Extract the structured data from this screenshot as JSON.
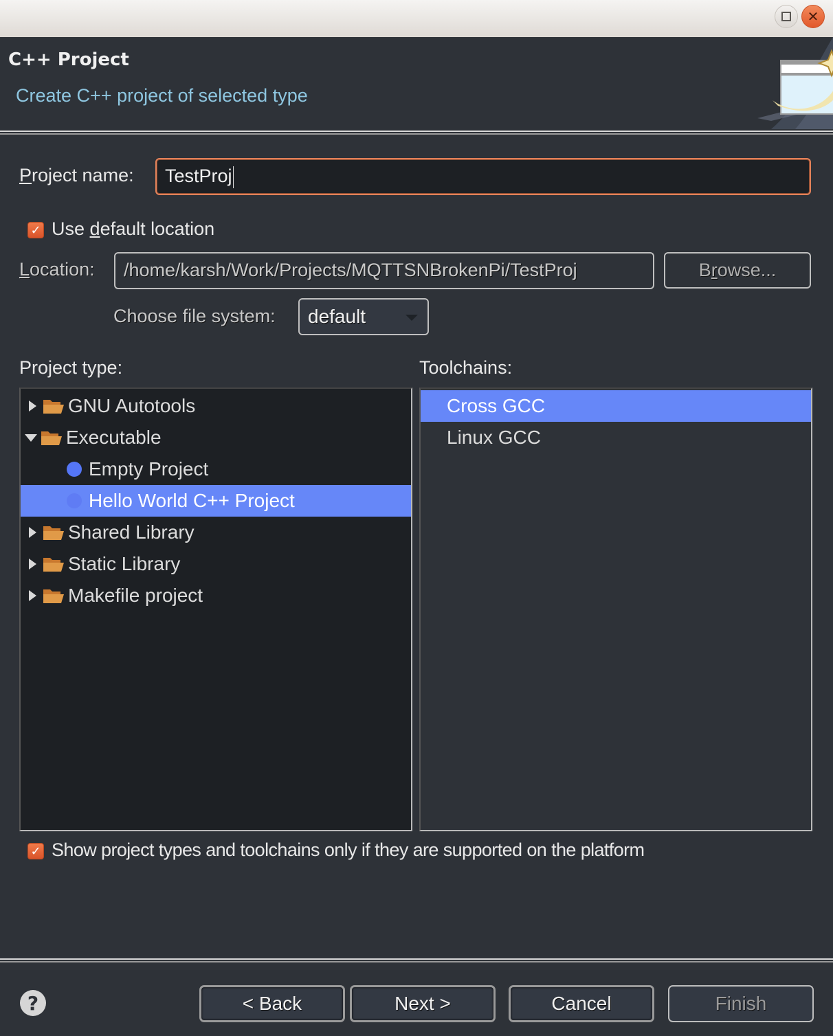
{
  "window": {
    "maximize_icon": "maximize-icon",
    "close_icon": "close-icon"
  },
  "header": {
    "title": "C++ Project",
    "subtitle": "Create C++ project of selected type",
    "banner_icon": "new-project-wizard-icon"
  },
  "form": {
    "project_name_label_mnemonic": "P",
    "project_name_label_rest": "roject name:",
    "project_name_value": "TestProj",
    "use_default_location": {
      "checked": true,
      "label_pre": "Use ",
      "label_mnemonic": "d",
      "label_post": "efault location"
    },
    "location_label_mnemonic": "L",
    "location_label_rest": "ocation:",
    "location_value": "/home/karsh/Work/Projects/MQTTSNBrokenPi/TestProj",
    "browse_pre": "B",
    "browse_mnemonic": "r",
    "browse_post": "owse...",
    "file_system_label": "Choose file system:",
    "file_system_value": "default"
  },
  "project_type": {
    "label": "Project type:",
    "items": [
      {
        "label": "GNU Autotools",
        "kind": "folder",
        "expanded": false,
        "level": 0
      },
      {
        "label": "Executable",
        "kind": "folder",
        "expanded": true,
        "level": 0
      },
      {
        "label": "Empty Project",
        "kind": "leaf",
        "level": 1
      },
      {
        "label": "Hello World C++ Project",
        "kind": "leaf",
        "level": 1,
        "selected": true
      },
      {
        "label": "Shared Library",
        "kind": "folder",
        "expanded": false,
        "level": 0
      },
      {
        "label": "Static Library",
        "kind": "folder",
        "expanded": false,
        "level": 0
      },
      {
        "label": "Makefile project",
        "kind": "folder",
        "expanded": false,
        "level": 0
      }
    ]
  },
  "toolchains": {
    "label": "Toolchains:",
    "items": [
      {
        "label": "Cross GCC",
        "selected": true
      },
      {
        "label": "Linux GCC",
        "selected": false
      }
    ]
  },
  "show_supported": {
    "checked": true,
    "label": "Show project types and toolchains only if they are supported on the platform"
  },
  "buttons": {
    "help": "?",
    "back": "< Back",
    "next": "Next >",
    "cancel": "Cancel",
    "finish": "Finish",
    "finish_enabled": false
  },
  "colors": {
    "background": "#2e3238",
    "selection": "#6687f8",
    "accent": "#e3825a",
    "subtitle": "#8ec6e0",
    "folder": "#e09a48"
  }
}
